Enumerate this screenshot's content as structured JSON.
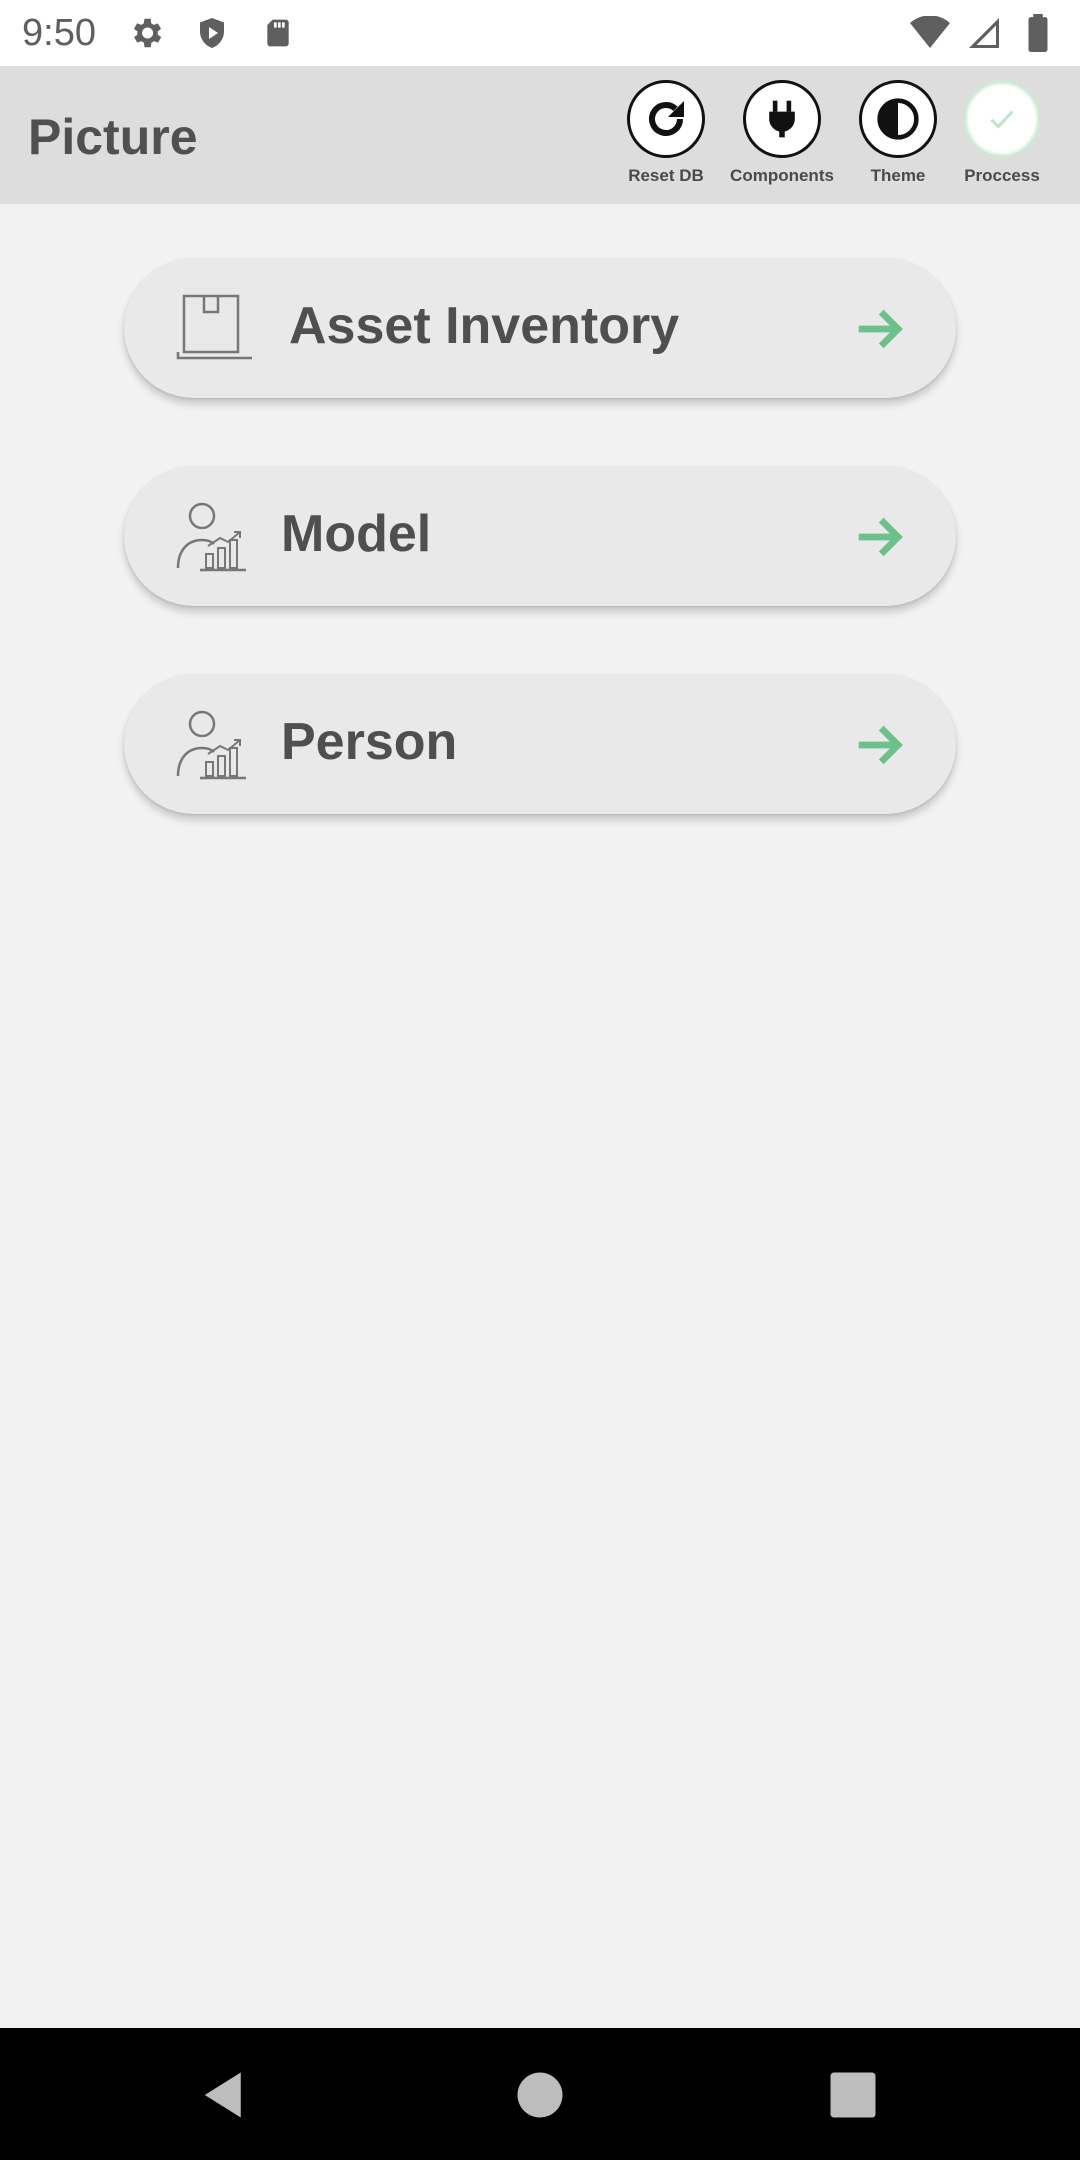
{
  "status_bar": {
    "time": "9:50",
    "icons_left": [
      "gear-icon",
      "shield-play-icon",
      "sd-card-icon"
    ],
    "icons_right": [
      "wifi-icon",
      "cell-signal-icon",
      "battery-icon"
    ]
  },
  "app_bar": {
    "title": "Picture",
    "actions": [
      {
        "label": "Reset DB",
        "icon": "refresh-icon"
      },
      {
        "label": "Components",
        "icon": "plug-icon"
      },
      {
        "label": "Theme",
        "icon": "contrast-icon"
      },
      {
        "label": "Proccess",
        "icon": "check-icon"
      }
    ]
  },
  "menu": {
    "items": [
      {
        "label": "Asset Inventory",
        "icon": "box-icon"
      },
      {
        "label": "Model",
        "icon": "person-chart-icon"
      },
      {
        "label": "Person",
        "icon": "person-chart-icon"
      }
    ],
    "arrow_color": "#6cc08b"
  },
  "nav_bar": {
    "buttons": [
      "back-icon",
      "home-icon",
      "recents-icon"
    ]
  }
}
